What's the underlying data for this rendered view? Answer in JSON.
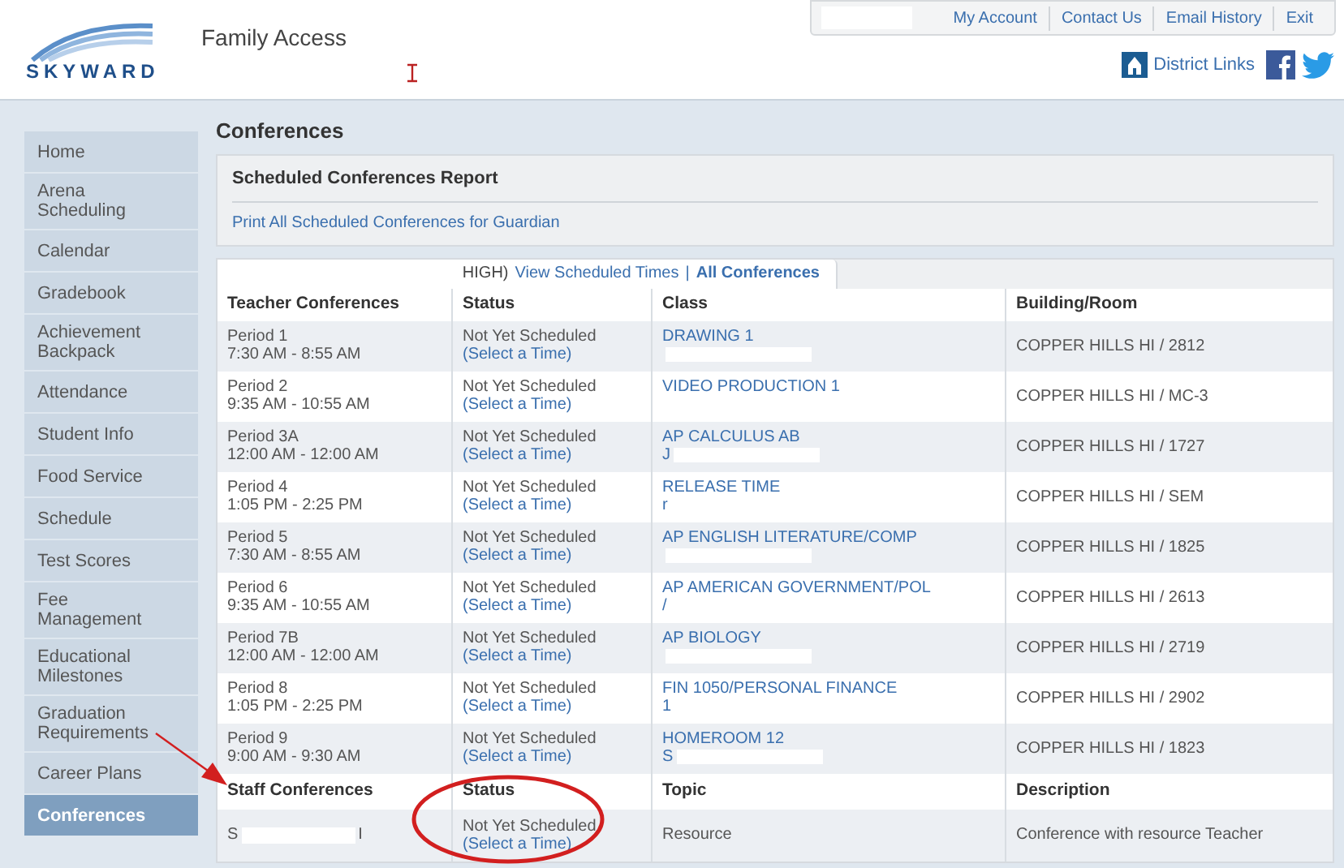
{
  "header": {
    "logo_text": "SKYWARD",
    "app_title": "Family Access",
    "top_links": [
      "My Account",
      "Contact Us",
      "Email History",
      "Exit"
    ],
    "district_links": "District Links"
  },
  "sidebar": {
    "items": [
      {
        "label": "Home",
        "selected": false
      },
      {
        "label": "Arena Scheduling",
        "selected": false
      },
      {
        "label": "Calendar",
        "selected": false
      },
      {
        "label": "Gradebook",
        "selected": false
      },
      {
        "label": "Achievement Backpack",
        "selected": false
      },
      {
        "label": "Attendance",
        "selected": false
      },
      {
        "label": "Student Info",
        "selected": false
      },
      {
        "label": "Food Service",
        "selected": false
      },
      {
        "label": "Schedule",
        "selected": false
      },
      {
        "label": "Test Scores",
        "selected": false
      },
      {
        "label": "Fee Management",
        "selected": false
      },
      {
        "label": "Educational Milestones",
        "selected": false
      },
      {
        "label": "Graduation Requirements",
        "selected": false
      },
      {
        "label": "Career Plans",
        "selected": false
      },
      {
        "label": "Conferences",
        "selected": true
      }
    ]
  },
  "page_title": "Conferences",
  "report": {
    "title": "Scheduled Conferences Report",
    "link": "Print All Scheduled Conferences for Guardian"
  },
  "tabs": {
    "prefix": "HIGH)",
    "items": [
      {
        "label": "View Scheduled Times",
        "selected": false
      },
      {
        "label": "All Conferences",
        "selected": true
      }
    ],
    "separator": "|"
  },
  "teacher_table": {
    "columns": [
      "Teacher Conferences",
      "Status",
      "Class",
      "Building/Room"
    ],
    "rows": [
      {
        "period": "Period 1",
        "time": "7:30 AM - 8:55 AM",
        "status": "Not Yet Scheduled",
        "action": "(Select a Time)",
        "class": "DRAWING 1",
        "teacher_fragment": "",
        "building": "COPPER HILLS HI / 2812"
      },
      {
        "period": "Period 2",
        "time": "9:35 AM - 10:55 AM",
        "status": "Not Yet Scheduled",
        "action": "(Select a Time)",
        "class": "VIDEO PRODUCTION 1",
        "teacher_fragment": "",
        "building": "COPPER HILLS HI / MC-3"
      },
      {
        "period": "Period 3A",
        "time": "12:00 AM - 12:00 AM",
        "status": "Not Yet Scheduled",
        "action": "(Select a Time)",
        "class": "AP CALCULUS AB",
        "teacher_fragment": "J",
        "building": "COPPER HILLS HI / 1727"
      },
      {
        "period": "Period 4",
        "time": "1:05 PM - 2:25 PM",
        "status": "Not Yet Scheduled",
        "action": "(Select a Time)",
        "class": "RELEASE TIME",
        "teacher_fragment": "r",
        "building": "COPPER HILLS HI / SEM"
      },
      {
        "period": "Period 5",
        "time": "7:30 AM - 8:55 AM",
        "status": "Not Yet Scheduled",
        "action": "(Select a Time)",
        "class": "AP ENGLISH LITERATURE/COMP",
        "teacher_fragment": "",
        "building": "COPPER HILLS HI / 1825"
      },
      {
        "period": "Period 6",
        "time": "9:35 AM - 10:55 AM",
        "status": "Not Yet Scheduled",
        "action": "(Select a Time)",
        "class": "AP AMERICAN GOVERNMENT/POL",
        "teacher_fragment": "/",
        "building": "COPPER HILLS HI / 2613"
      },
      {
        "period": "Period 7B",
        "time": "12:00 AM - 12:00 AM",
        "status": "Not Yet Scheduled",
        "action": "(Select a Time)",
        "class": "AP BIOLOGY",
        "teacher_fragment": "",
        "building": "COPPER HILLS HI / 2719"
      },
      {
        "period": "Period 8",
        "time": "1:05 PM - 2:25 PM",
        "status": "Not Yet Scheduled",
        "action": "(Select a Time)",
        "class": "FIN 1050/PERSONAL FINANCE",
        "teacher_fragment": "1",
        "building": "COPPER HILLS HI / 2902"
      },
      {
        "period": "Period 9",
        "time": "9:00 AM - 9:30 AM",
        "status": "Not Yet Scheduled",
        "action": "(Select a Time)",
        "class": "HOMEROOM 12",
        "teacher_fragment": "S",
        "building": "COPPER HILLS HI / 1823"
      }
    ]
  },
  "staff_table": {
    "columns": [
      "Staff Conferences",
      "Status",
      "Topic",
      "Description"
    ],
    "rows": [
      {
        "name_start": "S",
        "name_end": "I",
        "status": "Not Yet Scheduled",
        "action": "(Select a Time)",
        "topic": "Resource",
        "description": "Conference with resource Teacher"
      }
    ]
  }
}
